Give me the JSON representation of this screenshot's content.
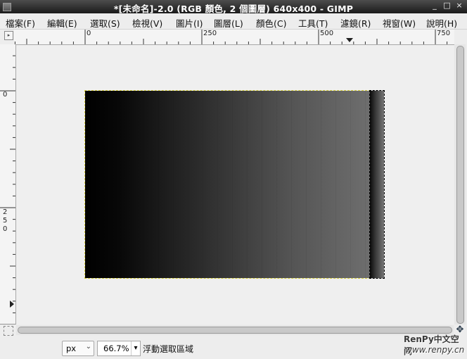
{
  "window": {
    "title": "*[未命名]-2.0 (RGB 顏色, 2 個圖層) 640x400 - GIMP",
    "controls": [
      "_",
      "□",
      "×"
    ]
  },
  "menubar": [
    {
      "label": "檔案(F)"
    },
    {
      "label": "編輯(E)"
    },
    {
      "label": "選取(S)"
    },
    {
      "label": "檢視(V)"
    },
    {
      "label": "圖片(I)"
    },
    {
      "label": "圖層(L)"
    },
    {
      "label": "顏色(C)"
    },
    {
      "label": "工具(T)"
    },
    {
      "label": "濾鏡(R)"
    },
    {
      "label": "視窗(W)"
    },
    {
      "label": "說明(H)"
    }
  ],
  "rulers": {
    "horizontal": [
      "0",
      "250",
      "500",
      "750"
    ],
    "vertical_0": "0",
    "vertical_250": [
      "2",
      "5",
      "0"
    ]
  },
  "statusbar": {
    "unit": "px",
    "zoom": "66.7%",
    "message": "浮動選取區域"
  },
  "watermark": {
    "line1": "RenPy中文空间",
    "line2": "www.renpy.cn"
  },
  "colors": {
    "selection_border": "#d8d040",
    "canvas_bg": "#efefef",
    "title_bar": "#2a2a2a"
  },
  "icons": {
    "quick_mask": "quick-mask-icon",
    "navigate": "navigate-icon",
    "menu_arrow": "ruler-corner-icon"
  }
}
